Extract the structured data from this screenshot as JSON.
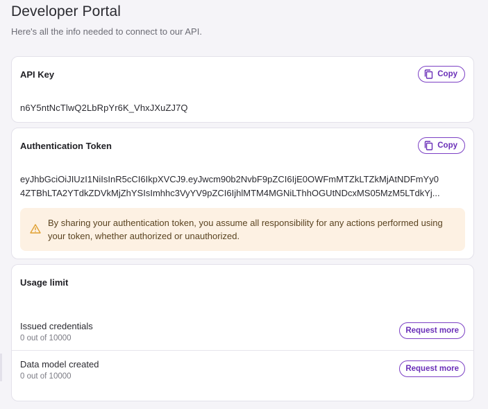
{
  "header": {
    "title": "Developer Portal",
    "subtitle": "Here's all the info needed to connect to our API."
  },
  "api_key": {
    "title": "API Key",
    "copy_label": "Copy",
    "value": "n6Y5ntNcTlwQ2LbRpYr6K_VhxJXuZJ7Q"
  },
  "auth_token": {
    "title": "Authentication Token",
    "copy_label": "Copy",
    "line1": "eyJhbGciOiJIUzI1NiIsInR5cCI6IkpXVCJ9.eyJwcm90b2NvbF9pZCI6IjE0OWFmMTZkLTZkMjAtNDFmYy0",
    "line2": "4ZTBhLTA2YTdkZDVkMjZhYSIsImhhc3VyYV9pZCI6IjhlMTM4MGNiLThhOGUtNDcxMS05MzM5LTdkYj...",
    "warning": "By sharing your authentication token, you assume all responsibility for any actions performed using your token, whether authorized or unauthorized."
  },
  "usage": {
    "title": "Usage limit",
    "rows": [
      {
        "label": "Issued credentials",
        "detail": "0 out of 10000",
        "button": "Request more"
      },
      {
        "label": "Data model created",
        "detail": "0 out of 10000",
        "button": "Request more"
      }
    ]
  },
  "colors": {
    "accent": "#6a2fb8",
    "warning_bg": "#fdf1e3",
    "warning_icon": "#e0a030"
  },
  "icons": {
    "copy": "copy-icon",
    "warning": "warning-triangle-icon"
  }
}
